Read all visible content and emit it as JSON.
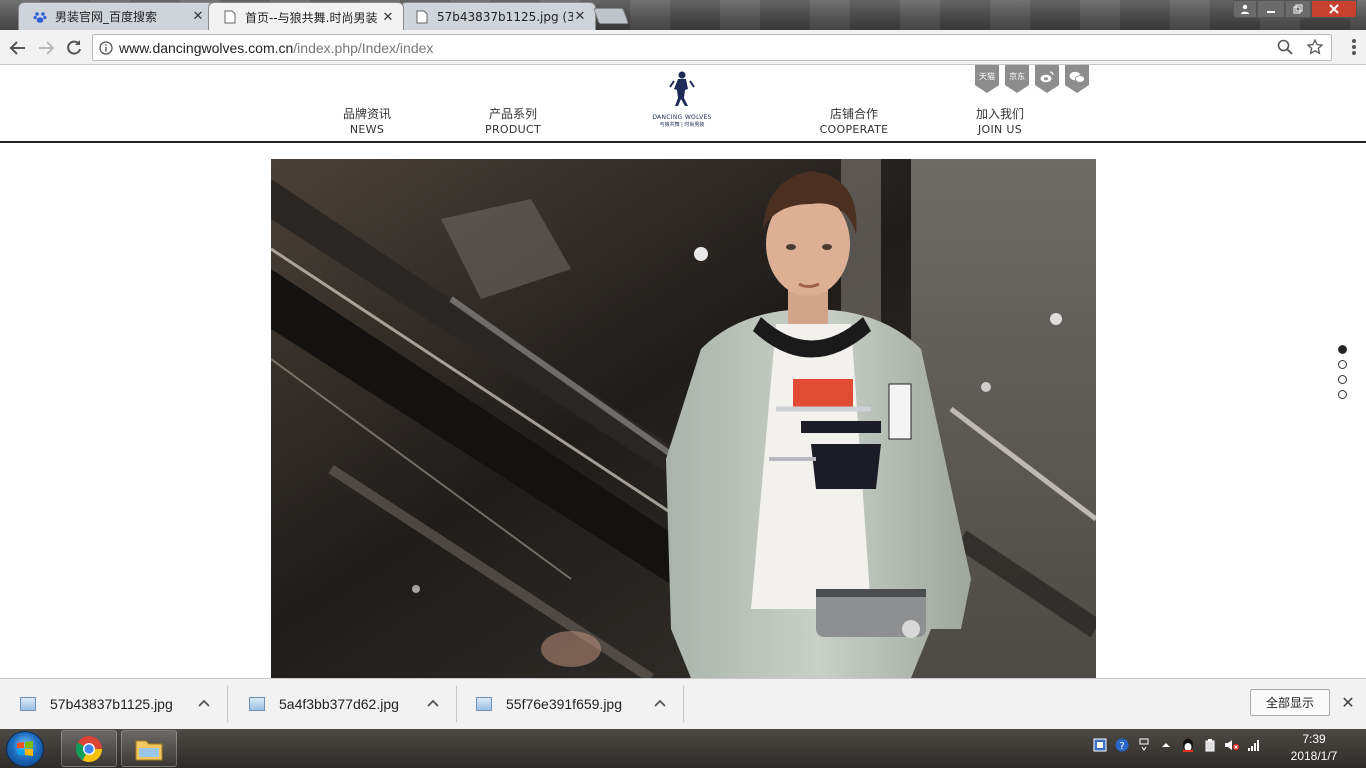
{
  "browser": {
    "tabs": [
      {
        "title": "男装官网_百度搜索",
        "icon": "baidu-paw-icon",
        "active": false
      },
      {
        "title": "首页--与狼共舞.时尚男装",
        "icon": "page-icon",
        "active": true
      },
      {
        "title": "57b43837b1125.jpg (3",
        "icon": "page-icon",
        "active": false
      }
    ],
    "url_host": "www.dancingwolves.com.cn",
    "url_path": "/index.php/Index/index"
  },
  "site": {
    "nav_left": [
      {
        "cn": "品牌资讯",
        "en": "NEWS"
      },
      {
        "cn": "产品系列",
        "en": "PRODUCT"
      }
    ],
    "nav_right": [
      {
        "cn": "店铺合作",
        "en": "COOPERATE"
      },
      {
        "cn": "加入我们",
        "en": "JOIN US"
      }
    ],
    "logo_text": "DANCING WOLVES",
    "logo_subtext": "与狼共舞 | 时尚男装",
    "social": [
      {
        "label": "天猫",
        "icon": "tmall-icon"
      },
      {
        "label": "京东",
        "icon": "jd-icon"
      },
      {
        "label": "",
        "icon": "weibo-icon"
      },
      {
        "label": "",
        "icon": "wechat-icon"
      }
    ],
    "slide_count": 4,
    "active_slide": 1
  },
  "downloads": {
    "items": [
      "57b43837b1125.jpg",
      "5a4f3bb377d62.jpg",
      "55f76e391f659.jpg"
    ],
    "show_all": "全部显示"
  },
  "taskbar": {
    "time": "7:39",
    "date": "2018/1/7"
  },
  "colors": {
    "accent": "#d33b2a",
    "navy": "#1e2b57"
  }
}
